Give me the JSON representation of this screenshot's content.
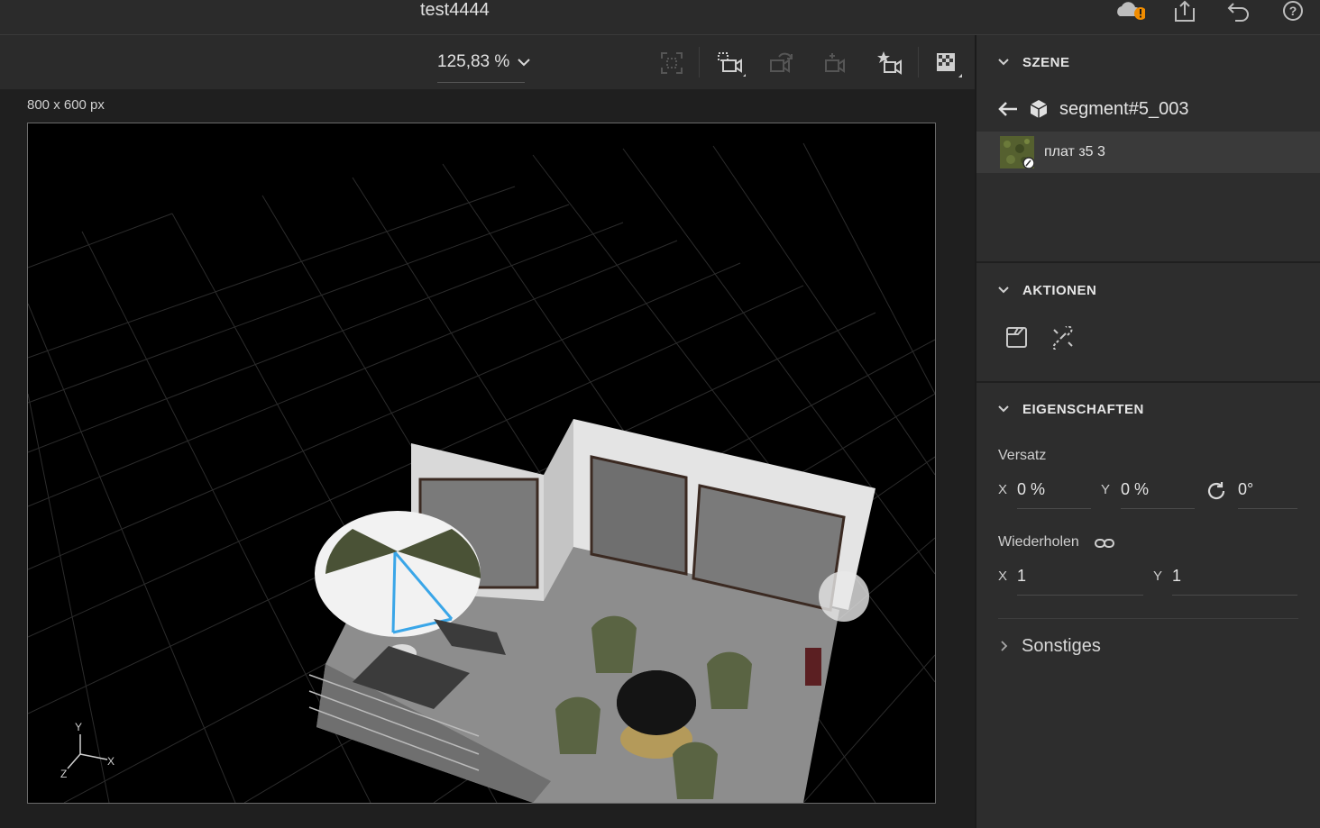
{
  "app": {
    "document_title": "test4444"
  },
  "topbar": {
    "icons": [
      "cloud-warning-icon",
      "share-icon",
      "undo-icon",
      "help-icon"
    ]
  },
  "toolbar": {
    "zoom_label": "125,83 %",
    "tools": [
      "frame-select-icon",
      "camera-view-icon",
      "camera-orbit-icon",
      "camera-pan-icon",
      "camera-bookmark-icon",
      "render-preview-icon"
    ]
  },
  "canvas": {
    "size_label": "800 x 600 px",
    "axes": {
      "x": "X",
      "y": "Y",
      "z": "Z"
    }
  },
  "panel": {
    "scene": {
      "title": "SZENE",
      "path_label": "segment#5_003",
      "material_name": "плат з5 3"
    },
    "actions": {
      "title": "AKTIONEN",
      "icons": [
        "edit-material-icon",
        "unlink-icon"
      ]
    },
    "properties": {
      "title": "EIGENSCHAFTEN",
      "offset_label": "Versatz",
      "offset_x_label": "X",
      "offset_x_value": "0 %",
      "offset_y_label": "Y",
      "offset_y_value": "0 %",
      "rotation_value": "0°",
      "repeat_label": "Wiederholen",
      "repeat_x_label": "X",
      "repeat_x_value": "1",
      "repeat_y_label": "Y",
      "repeat_y_value": "1"
    },
    "misc": {
      "title": "Sonstiges"
    }
  },
  "colors": {
    "accent_warning": "#f08c00",
    "selection_outline": "#3aa6e8"
  }
}
